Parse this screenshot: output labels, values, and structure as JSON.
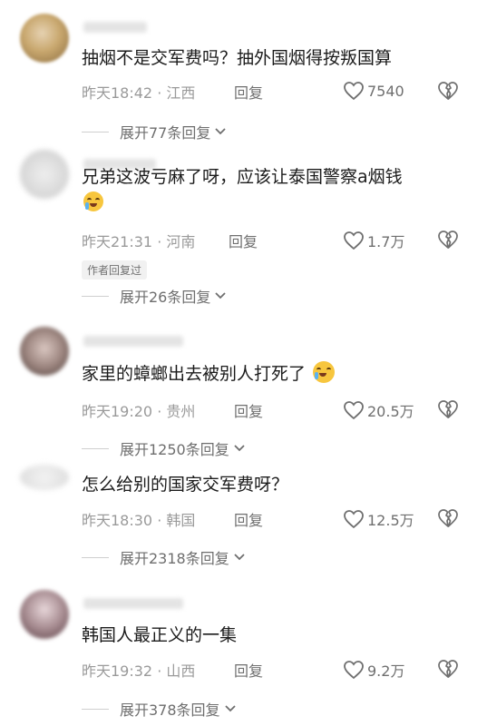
{
  "comments": [
    {
      "text": "抽烟不是交军费吗？抽外国烟得按叛国算",
      "time": "昨天18:42 · 江西",
      "reply_label": "回复",
      "likes": "7540",
      "expand": "展开77条回复"
    },
    {
      "text": "兄弟这波亏麻了呀，应该让泰国警察a烟钱",
      "time": "昨天21:31 · 河南",
      "reply_label": "回复",
      "likes": "1.7万",
      "author_tag": "作者回复过",
      "expand": "展开26条回复"
    },
    {
      "text": "家里的蟑螂出去被别人打死了",
      "time": "昨天19:20 · 贵州",
      "reply_label": "回复",
      "likes": "20.5万",
      "expand": "展开1250条回复"
    },
    {
      "text": "怎么给别的国家交军费呀？",
      "time": "昨天18:30 · 韩国",
      "reply_label": "回复",
      "likes": "12.5万",
      "expand": "展开2318条回复"
    },
    {
      "text": "韩国人最正义的一集",
      "time": "昨天19:32 · 山西",
      "reply_label": "回复",
      "likes": "9.2万",
      "expand": "展开378条回复"
    }
  ],
  "icons": {
    "like": "heart-outline-icon",
    "dislike": "broken-heart-icon",
    "expand": "chevron-down-icon"
  },
  "colors": {
    "text": "#1b1b1b",
    "meta": "#9a9a9a",
    "muted": "#6e6e6e"
  }
}
